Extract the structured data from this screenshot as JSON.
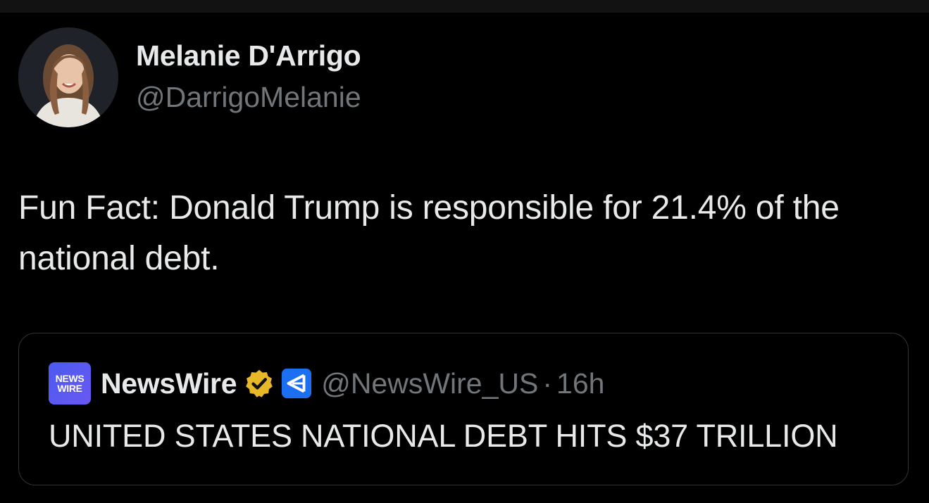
{
  "tweet": {
    "author_name": "Melanie D'Arrigo",
    "author_handle": "@DarrigoMelanie",
    "text": "Fun Fact: Donald Trump is responsible for 21.4% of the national debt."
  },
  "quote": {
    "logo_line1": "NEWS",
    "logo_line2": "WIRE",
    "author_name": "NewsWire",
    "author_handle": "@NewsWire_US",
    "separator": "·",
    "time": "16h",
    "text": "UNITED STATES NATIONAL DEBT HITS $37 TRILLION",
    "badges": [
      "verified-gold-icon",
      "affiliate-icon"
    ]
  },
  "colors": {
    "background": "#000000",
    "text_primary": "#e7e9ea",
    "text_secondary": "#71767b",
    "border": "#2f3336",
    "verified_gold": "#e8b829",
    "affiliate_blue": "#1d6ff2",
    "logo_purple": "#5b5cf0"
  }
}
